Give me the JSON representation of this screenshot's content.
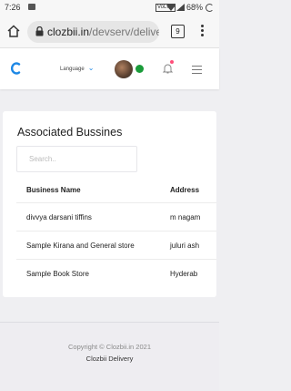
{
  "status_bar": {
    "time": "7:26",
    "volte": "VoLTE",
    "battery": "68%"
  },
  "browser": {
    "url_domain": "clozbii.in",
    "url_path": "/devserv/delive",
    "tab_count": "9"
  },
  "header": {
    "language_label": "Language",
    "colors": {
      "logo": "#1e88e5",
      "online": "#1a9b3a",
      "notification_dot": "#ff4f7a"
    }
  },
  "card": {
    "title": "Associated Bussines",
    "search_placeholder": "Search..",
    "columns": [
      "Business Name",
      "Address"
    ],
    "rows": [
      {
        "name": "divvya darsani tiffins",
        "address": "m nagam"
      },
      {
        "name": "Sample Kirana and General store",
        "address": "juluri ash"
      },
      {
        "name": "Sample Book Store",
        "address": "Hyderab"
      }
    ]
  },
  "footer": {
    "copyright": "Copyright © Clozbii.in 2021",
    "brand": "Clozbii Delivery"
  }
}
